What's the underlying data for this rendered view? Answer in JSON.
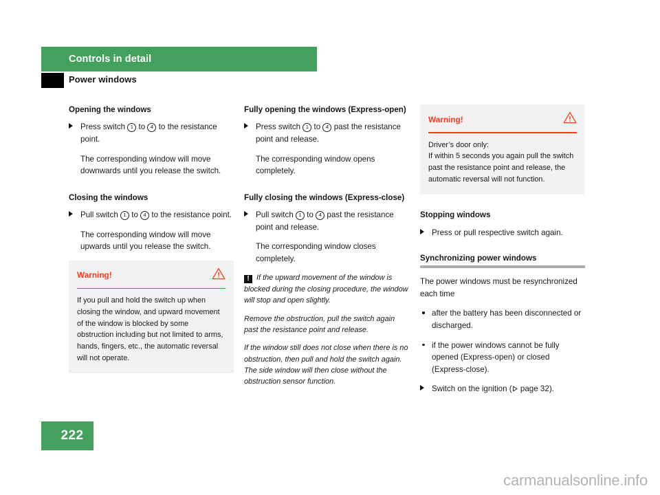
{
  "header": {
    "chapter": "Controls in detail",
    "section": "Power windows"
  },
  "columns": {
    "col1": {
      "heading_opening": "Opening the windows",
      "step_press_prefix": "Press switch",
      "num_1": "1",
      "to_word": "to",
      "num_4": "4",
      "step_press_suffix": "to the resistance point.",
      "para_opening_result": "The corresponding window will move downwards until you release the switch.",
      "heading_closing": "Closing the windows",
      "step_pull_prefix": "Pull switch",
      "step_pull_suffix": "to the resistance point.",
      "para_closing_result": "The corresponding window will move upwards until you release the switch.",
      "warning": {
        "title": "Warning!",
        "icon": "warning-triangle-icon",
        "body": "If you pull and hold the switch up when closing the window, and upward movement of the window is blocked by some obstruction including but not limited to arms, hands, fingers, etc., the automatic reversal will not operate."
      }
    },
    "col2": {
      "heading_fully_opening": "Fully opening the windows (Express-open)",
      "step_press_prefix": "Press switch",
      "num_1": "1",
      "to_word": "to",
      "num_4": "4",
      "step_press_suffix": "past the resistance point and release.",
      "para_opens_completely": "The corresponding window opens completely.",
      "heading_fully_closing": "Fully closing the windows (Express-close)",
      "step_pull_prefix": "Pull switch",
      "step_pull_suffix": "past the resistance point and release.",
      "para_closes_completely": "The corresponding window closes completely.",
      "note": {
        "icon": "note-exclamation-icon",
        "para1": "If the upward movement of the window is blocked during the closing procedure, the window will stop and open slightly.",
        "para2": "Remove the obstruction, pull the switch again past the resistance point and release.",
        "para3": "If the window still does not close when there is no obstruction, then pull and hold the switch again. The side window will then close without the obstruction sensor function."
      }
    },
    "col3": {
      "warning": {
        "title": "Warning!",
        "icon": "warning-triangle-icon",
        "body": "Driver’s door only:\nIf within 5 seconds you again pull the switch past the resistance point and release, the automatic reversal will not function."
      },
      "heading_stopping": "Stopping windows",
      "step_stopping": "Press or pull respective switch again.",
      "heading_sync": "Synchronizing power windows",
      "para_sync_intro": "The power windows must be resynchronized each time",
      "bullet_1": "after the battery has been disconnected or discharged.",
      "bullet_2": "if the power windows cannot be fully opened (Express-open) or closed (Express-close).",
      "step_ignition_prefix": "Switch on the ignition (",
      "step_ignition_ref": "page 32",
      "step_ignition_suffix": ")."
    }
  },
  "footer": {
    "page_number": "222",
    "watermark": "carmanualsonline.info"
  },
  "colors": {
    "chapter_green": "#44a05d",
    "warning_red": "#fa3c1e",
    "warning_bg": "#f2f2f2",
    "rule_gray": "#aeaeae"
  }
}
